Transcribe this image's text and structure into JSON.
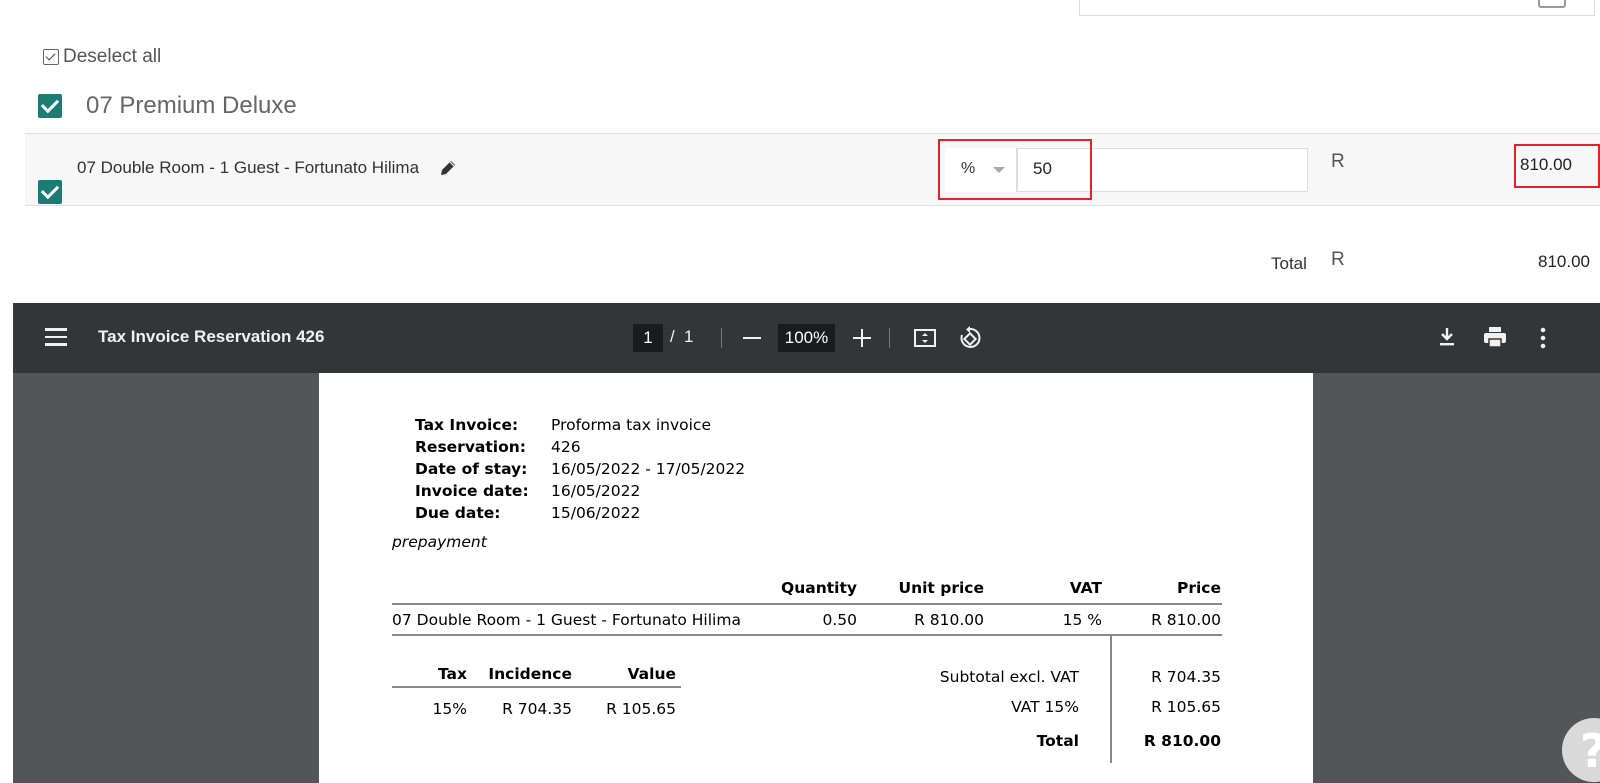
{
  "selection": {
    "deselect_label": "Deselect all",
    "group_title": "07 Premium Deluxe",
    "line": {
      "label": "07 Double Room - 1 Guest - Fortunato Hilima",
      "discount_type": "%",
      "discount_value": "50",
      "currency": "R",
      "amount": "810.00"
    },
    "total_label": "Total",
    "total_currency": "R",
    "total_amount": "810.00"
  },
  "pdf_viewer": {
    "title": "Tax Invoice Reservation 426",
    "current_page": "1",
    "page_separator": "/",
    "page_count": "1",
    "zoom": "100%",
    "icons": [
      "menu-icon",
      "zoom-out-icon",
      "zoom-in-icon",
      "fit-page-icon",
      "rotate-icon",
      "download-icon",
      "print-icon",
      "more-options-icon"
    ]
  },
  "invoice": {
    "fields": [
      {
        "label": "Tax Invoice:",
        "value": "Proforma tax invoice"
      },
      {
        "label": "Reservation:",
        "value": "426"
      },
      {
        "label": "Date of stay:",
        "value": "16/05/2022 - 17/05/2022"
      },
      {
        "label": "Invoice date:",
        "value": "16/05/2022"
      },
      {
        "label": "Due date:",
        "value": "15/06/2022"
      }
    ],
    "note": "prepayment",
    "line_headers": {
      "quantity": "Quantity",
      "unit_price": "Unit price",
      "vat": "VAT",
      "price": "Price"
    },
    "lines": [
      {
        "description": "07 Double Room - 1 Guest - Fortunato Hilima",
        "quantity": "0.50",
        "unit_price": "R 810.00",
        "vat": "15 %",
        "price": "R 810.00"
      }
    ],
    "tax_headers": {
      "tax": "Tax",
      "incidence": "Incidence",
      "value": "Value"
    },
    "tax_rows": [
      {
        "tax": "15%",
        "incidence": "R 704.35",
        "value": "R 105.65"
      }
    ],
    "totals": [
      {
        "label": "Subtotal excl. VAT",
        "value": "R 704.35"
      },
      {
        "label": "VAT 15%",
        "value": "R 105.65"
      },
      {
        "label": "Total",
        "value": "R 810.00"
      }
    ]
  },
  "help_label": "?",
  "colors": {
    "checkbox": "#1c7c74",
    "highlight": "#e8202a",
    "toolbar": "#323639",
    "viewer_bg": "#525659"
  }
}
